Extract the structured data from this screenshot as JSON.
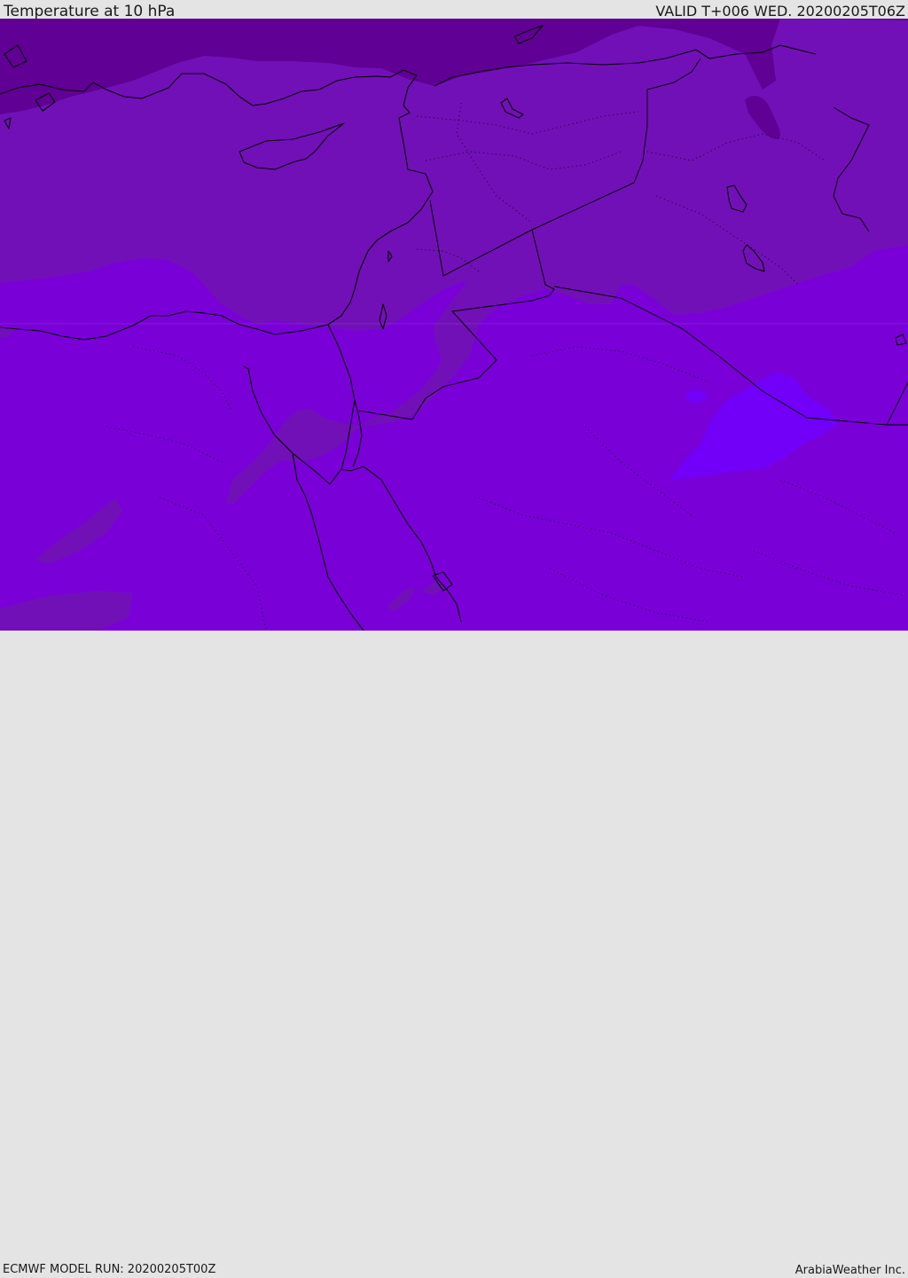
{
  "header": {
    "title": "Temperature at 10 hPa",
    "valid": "VALID T+006 WED. 20200205T06Z"
  },
  "footer": {
    "model_run": "ECMWF MODEL RUN: 20200205T00Z",
    "credit": "ArabiaWeather Inc."
  },
  "colors": {
    "band_darkest": "#600094",
    "band_dark": "#7210b8",
    "band_medium": "#7a00d8",
    "band_light": "#7200f8",
    "border_line": "#000000"
  }
}
